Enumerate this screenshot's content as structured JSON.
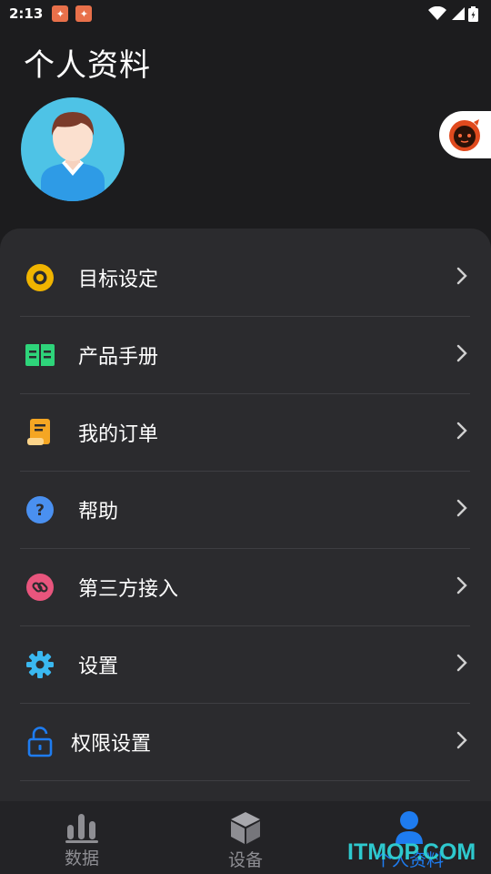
{
  "status_bar": {
    "time": "2:13"
  },
  "header": {
    "title": "个人资料"
  },
  "menu": {
    "items": [
      {
        "label": "目标设定",
        "icon": "target-icon",
        "color": "#f0b400"
      },
      {
        "label": "产品手册",
        "icon": "book-icon",
        "color": "#2ed47a"
      },
      {
        "label": "我的订单",
        "icon": "order-icon",
        "color": "#f5a623"
      },
      {
        "label": "帮助",
        "icon": "help-icon",
        "color": "#4a90f0"
      },
      {
        "label": "第三方接入",
        "icon": "link-icon",
        "color": "#e8557d"
      },
      {
        "label": "设置",
        "icon": "gear-icon",
        "color": "#3ab8f0"
      },
      {
        "label": "权限设置",
        "icon": "unlock-icon",
        "color": "#1e7cf0"
      }
    ]
  },
  "bottom_nav": {
    "items": [
      {
        "label": "数据",
        "icon": "bar-chart-icon",
        "active": false
      },
      {
        "label": "设备",
        "icon": "cube-icon",
        "active": false
      },
      {
        "label": "个人资料",
        "icon": "person-icon",
        "active": true
      }
    ]
  },
  "watermark": "ITMOP.COM",
  "colors": {
    "background": "#1c1c1e",
    "card": "#2b2b2e",
    "accent": "#1e7cf0"
  }
}
